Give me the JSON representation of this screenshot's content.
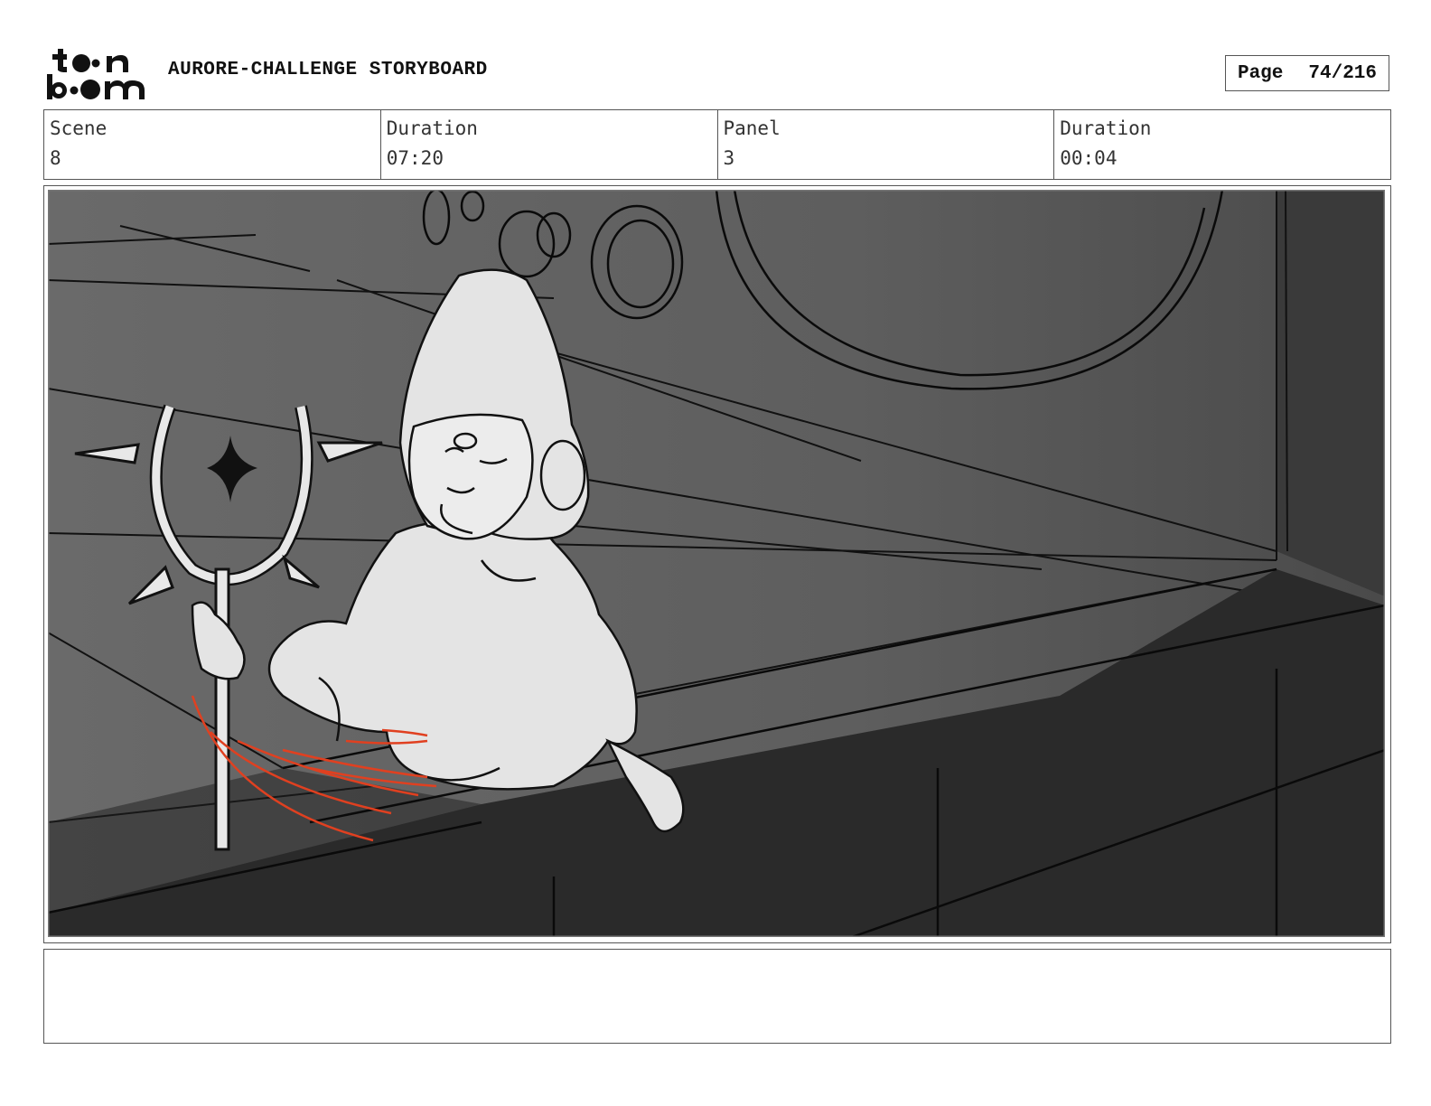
{
  "header": {
    "logo": {
      "top_text": "toon",
      "bottom_text": "boom"
    },
    "title": "AURORE-CHALLENGE STORYBOARD",
    "page_label": "Page",
    "page_value": "74/216"
  },
  "info": {
    "scene_label": "Scene",
    "scene_value": "8",
    "scene_duration_label": "Duration",
    "scene_duration_value": "07:20",
    "panel_label": "Panel",
    "panel_value": "3",
    "panel_duration_label": "Duration",
    "panel_duration_value": "00:04"
  },
  "notes": {
    "text": ""
  },
  "colors": {
    "accent_stroke": "#e04020",
    "sketch_fill": "#e4e4e4"
  }
}
